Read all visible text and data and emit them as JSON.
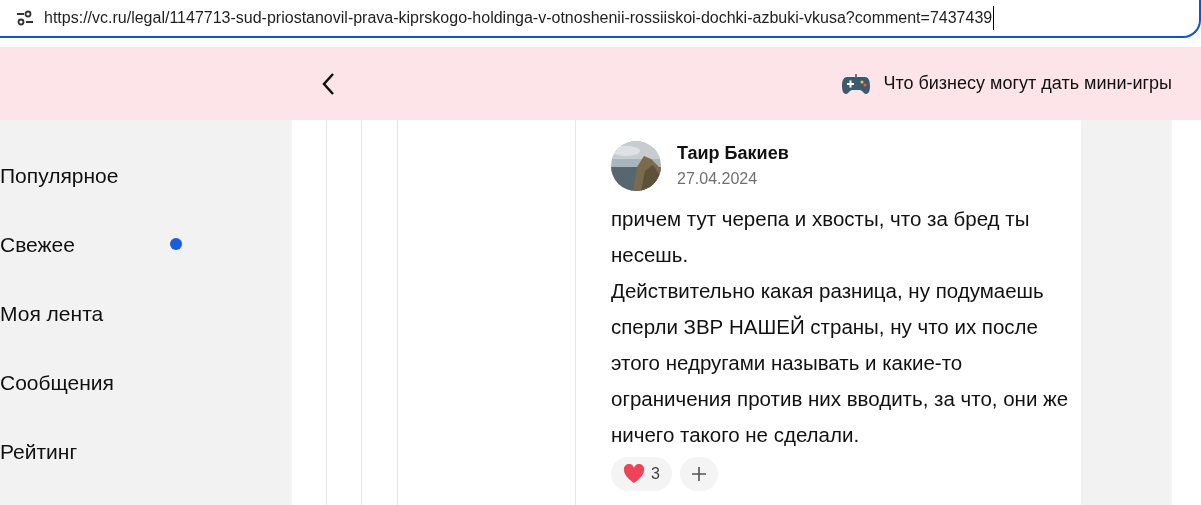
{
  "address_bar": {
    "url": "https://vc.ru/legal/1147713-sud-priostanovil-prava-kiprskogo-holdinga-v-otnoshenii-rossiiskoi-dochki-azbuki-vkusa?comment=7437439"
  },
  "banner": {
    "text": "Что бизнесу могут дать мини-игры"
  },
  "sidebar": {
    "items": [
      {
        "label": "Популярное",
        "unread": false
      },
      {
        "label": "Свежее",
        "unread": true
      },
      {
        "label": "Моя лента",
        "unread": false
      },
      {
        "label": "Сообщения",
        "unread": false
      },
      {
        "label": "Рейтинг",
        "unread": false
      }
    ]
  },
  "comment": {
    "author": "Таир Бакиев",
    "date": "27.04.2024",
    "paragraphs": [
      "причем тут черепа и хвосты, что за бред ты несешь.",
      "Действительно какая разница, ну подумаешь сперли ЗВР НАШЕЙ страны, ну что их после этого недругами называть и какие-то ограничения против них вводить, за что, они же ничего такого не сделали."
    ],
    "reactions": [
      {
        "count": "3"
      }
    ]
  }
}
